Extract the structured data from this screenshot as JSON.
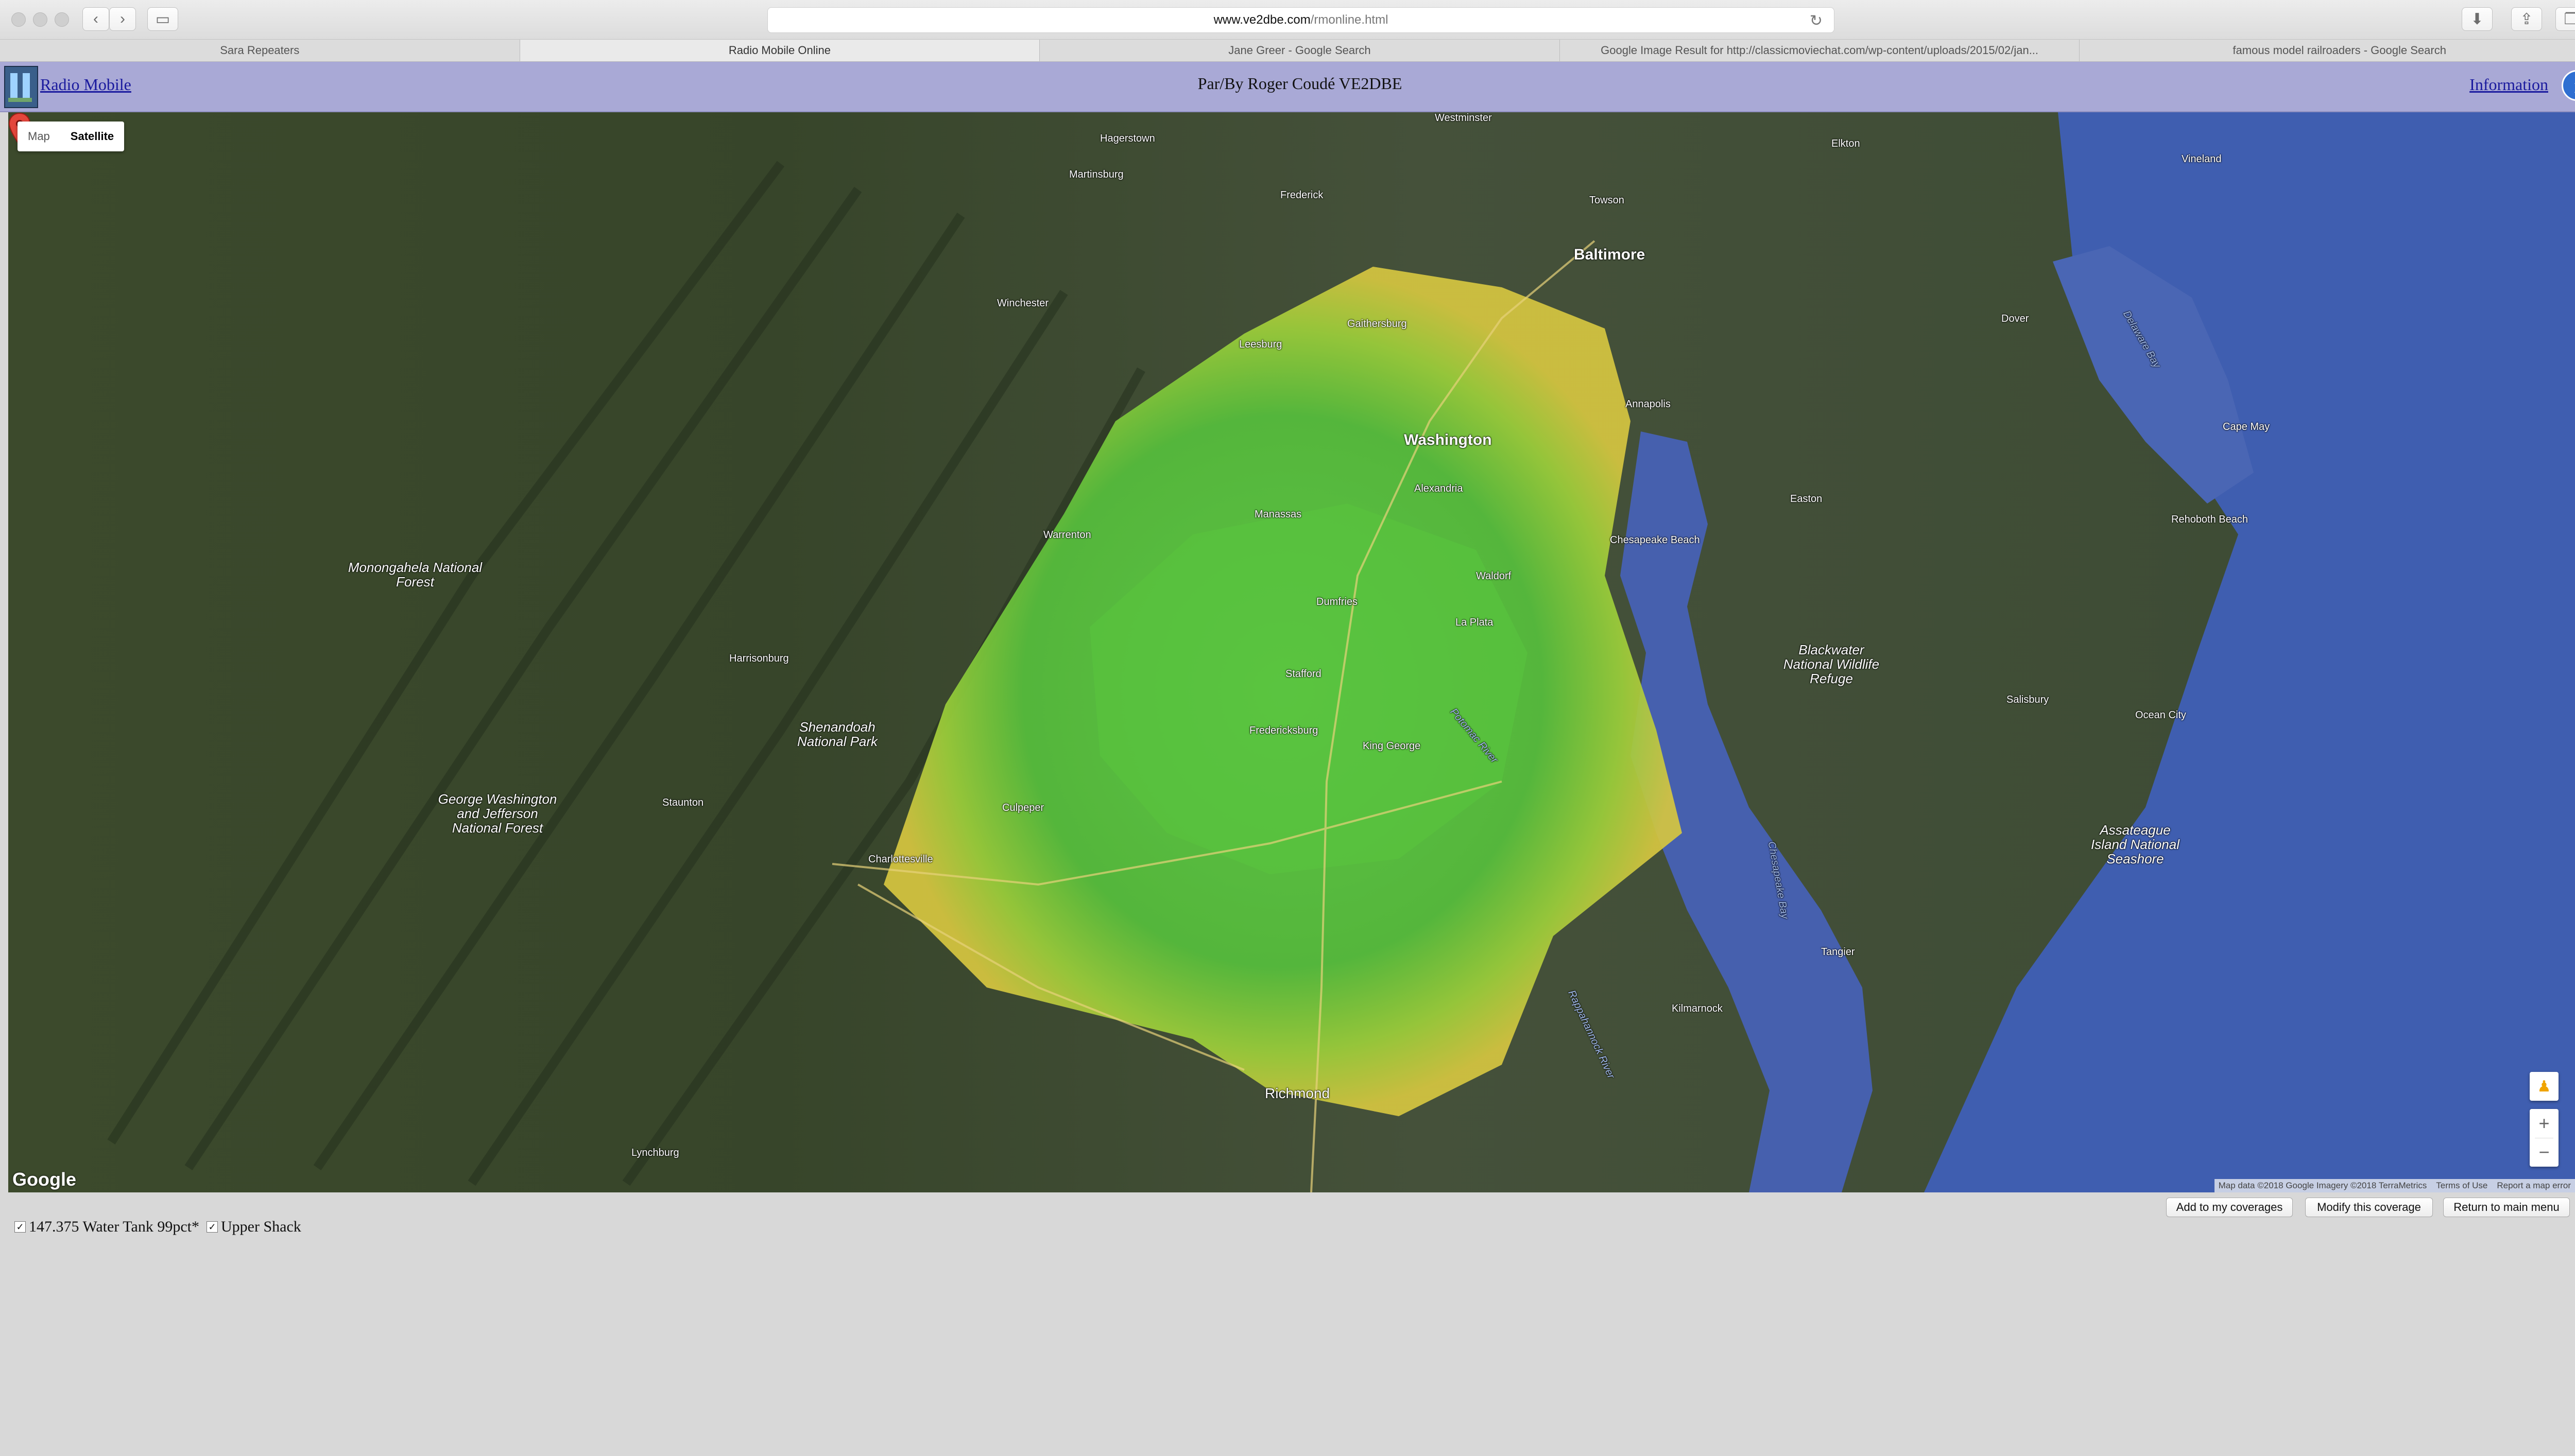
{
  "browser": {
    "url_host": "www.ve2dbe.com",
    "url_path": "/rmonline.html",
    "tabs": [
      {
        "label": "Sara Repeaters",
        "active": false
      },
      {
        "label": "Radio Mobile Online",
        "active": true
      },
      {
        "label": "Jane Greer - Google Search",
        "active": false
      },
      {
        "label": "Google Image Result for http://classicmoviechat.com/wp-content/uploads/2015/02/jan...",
        "active": false
      },
      {
        "label": "famous model railroaders - Google Search",
        "active": false
      }
    ]
  },
  "header": {
    "brand": "Radio Mobile",
    "author": "Par/By Roger Coudé VE2DBE",
    "info_link": "Information",
    "info_icon": "info-icon"
  },
  "map": {
    "type_buttons": {
      "map": "Map",
      "satellite": "Satellite",
      "selected": "Satellite"
    },
    "google_logo": "Google",
    "attribution": {
      "data": "Map data ©2018 Google Imagery ©2018 TerraMetrics",
      "terms": "Terms of Use",
      "report": "Report a map error"
    },
    "zoom_in": "+",
    "zoom_out": "−",
    "pegman_icon": "pegman-icon",
    "marker_icon": "map-pin-icon",
    "coverage_colors": {
      "strong": "#4fc23a",
      "medium": "#9ccf3a",
      "weak": "#d6c640"
    },
    "labels": {
      "baltimore": "Baltimore",
      "washington": "Washington",
      "alexandria": "Alexandria",
      "annapolis": "Annapolis",
      "frederick": "Frederick",
      "richmond": "Richmond",
      "fredericksburg": "Fredericksburg",
      "stafford": "Stafford",
      "charlottesville": "Charlottesville",
      "harrisonburg": "Harrisonburg",
      "winchester": "Winchester",
      "staunton": "Staunton",
      "lynchburg": "Lynchburg",
      "dover": "Dover",
      "salisbury": "Salisbury",
      "ocean_city": "Ocean City",
      "manassas": "Manassas",
      "warrenton": "Warrenton",
      "culpeper": "Culpeper",
      "gaithersburg": "Gaithersburg",
      "easton": "Easton",
      "chesapeake_beach": "Chesapeake Beach",
      "leesburg": "Leesburg",
      "martinsburg": "Martinsburg",
      "hagerstown": "Hagerstown",
      "westminster": "Westminster",
      "towson": "Towson",
      "elkton": "Elkton",
      "vineland": "Vineland",
      "cape_may": "Cape May",
      "rehoboth": "Rehoboth Beach",
      "tangier": "Tangier",
      "kilmarnock": "Kilmarnock",
      "king_george": "King George",
      "dumfries": "Dumfries",
      "waldorf": "Waldorf",
      "la_plata": "La Plata",
      "monongahela": "Monongahela National Forest",
      "shenandoah": "Shenandoah National Park",
      "gw_forest": "George Washington and Jefferson National Forest",
      "blackwater": "Blackwater National Wildlife Refuge",
      "assateague": "Assateague Island National Seashore",
      "delaware_bay": "Delaware Bay",
      "chesapeake_bay": "Chesapeake Bay",
      "potomac": "Potomac River",
      "rappahannock": "Rappahannock River"
    }
  },
  "legend": {
    "items": [
      {
        "label": "147.375 Water Tank 99pct*",
        "checked": true
      },
      {
        "label": "Upper Shack",
        "checked": true
      }
    ]
  },
  "buttons": {
    "add": "Add to my coverages",
    "modify": "Modify this coverage",
    "return": "Return to main menu"
  }
}
